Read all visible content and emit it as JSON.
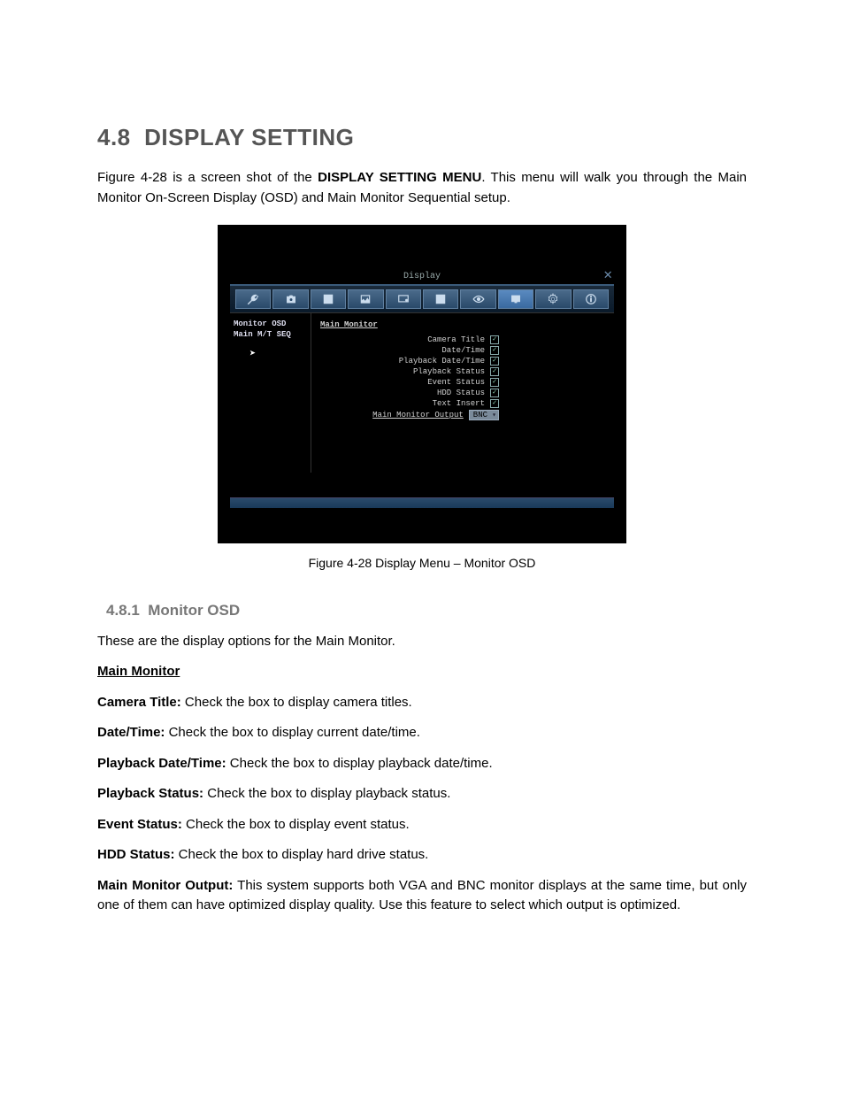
{
  "section": {
    "number": "4.8",
    "title": "DISPLAY SETTING",
    "intro_pre": "Figure 4-28 is a screen shot of the ",
    "intro_bold": "DISPLAY SETTING MENU",
    "intro_post": ". This menu will walk you through the Main Monitor On-Screen Display (OSD) and Main Monitor Sequential setup."
  },
  "screenshot": {
    "window_title": "Display",
    "close_glyph": "✕",
    "toolbar_icons": [
      "wrench-icon",
      "camera-icon",
      "grid-icon",
      "image-icon",
      "monitor-icon",
      "layout-icon",
      "eye-icon",
      "display-icon",
      "gear-icon",
      "info-icon"
    ],
    "sidebar": {
      "items": [
        "Monitor OSD",
        "Main M/T SEQ"
      ]
    },
    "panel": {
      "heading": "Main Monitor",
      "rows": [
        {
          "label": "Camera Title",
          "checked": true
        },
        {
          "label": "Date/Time",
          "checked": true
        },
        {
          "label": "Playback Date/Time",
          "checked": true
        },
        {
          "label": "Playback Status",
          "checked": true
        },
        {
          "label": "Event Status",
          "checked": true
        },
        {
          "label": "HDD Status",
          "checked": true
        },
        {
          "label": "Text Insert",
          "checked": true
        }
      ],
      "output_label": "Main Monitor Output",
      "output_value": "BNC"
    },
    "cursor_glyph": "↖"
  },
  "figure_caption": "Figure 4-28 Display Menu – Monitor OSD",
  "subsection": {
    "number": "4.8.1",
    "title": "Monitor OSD",
    "intro": "These are the display options for the Main Monitor.",
    "group_heading": "Main Monitor",
    "options": [
      {
        "label": "Camera Title:",
        "text": " Check the box to display camera titles."
      },
      {
        "label": "Date/Time:",
        "text": " Check the box to display current date/time."
      },
      {
        "label": "Playback Date/Time:",
        "text": " Check the box to display playback date/time."
      },
      {
        "label": "Playback Status:",
        "text": " Check the box to display playback status."
      },
      {
        "label": "Event Status:",
        "text": " Check the box to display event status."
      },
      {
        "label": "HDD Status:",
        "text": " Check the box to display hard drive status."
      },
      {
        "label": "Main Monitor Output:",
        "text": "  This system supports both VGA and BNC monitor displays at the same time, but only one of them can have optimized display quality. Use this feature to select which output is optimized."
      }
    ]
  }
}
